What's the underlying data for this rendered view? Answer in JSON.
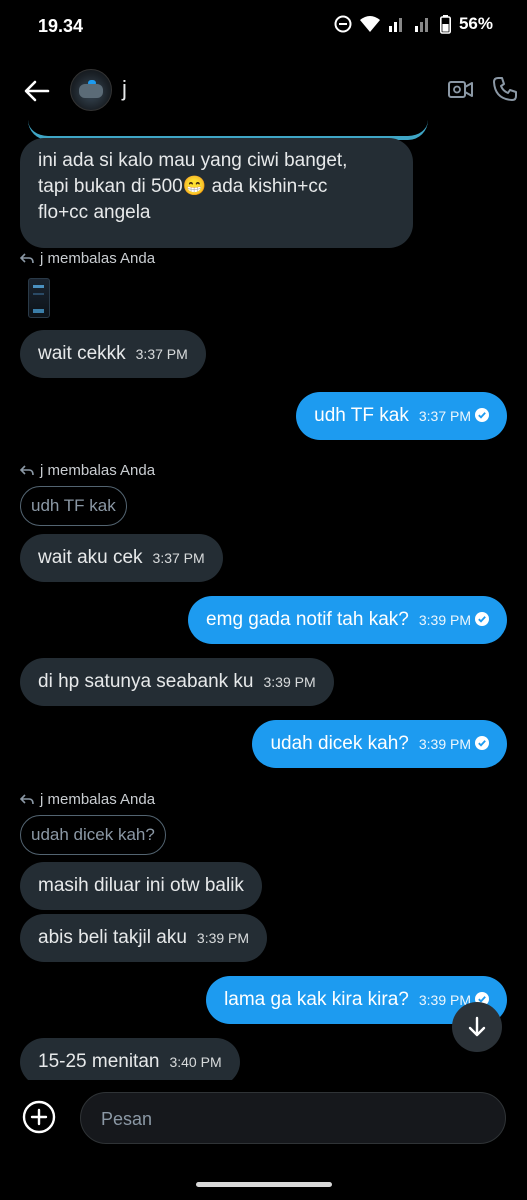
{
  "status_bar": {
    "time": "19.34",
    "battery": "56%"
  },
  "header": {
    "contact_name": "j"
  },
  "messages": {
    "m1": {
      "line1": "ini ada si kalo mau yang ciwi banget,",
      "line2": "tapi bukan di 500😁 ada kishin+cc",
      "line3": "flo+cc angela"
    },
    "r1": {
      "label": "j membalas Anda"
    },
    "m2": {
      "text": "wait cekkk",
      "time": "3:37 PM"
    },
    "m3": {
      "text": "udh TF kak",
      "time": "3:37 PM"
    },
    "r2": {
      "label": "j membalas Anda",
      "quote": "udh TF kak"
    },
    "m4": {
      "text": "wait aku cek",
      "time": "3:37 PM"
    },
    "m5": {
      "text": "emg gada notif tah kak?",
      "time": "3:39 PM"
    },
    "m6": {
      "text": "di hp satunya seabank ku",
      "time": "3:39 PM"
    },
    "m7": {
      "text": "udah dicek kah?",
      "time": "3:39 PM"
    },
    "r3": {
      "label": "j membalas Anda",
      "quote": "udah dicek kah?"
    },
    "m8": {
      "text": "masih diluar ini otw balik"
    },
    "m9": {
      "text": "abis beli takjil aku",
      "time": "3:39 PM"
    },
    "m10": {
      "text": "lama ga kak kira kira?",
      "time": "3:39 PM"
    },
    "m11": {
      "text": "15-25 menitan",
      "time": "3:40 PM"
    }
  },
  "composer": {
    "placeholder": "Pesan"
  },
  "colors": {
    "accent": "#1d9bf0",
    "incoming_bubble": "#242d34",
    "background": "#000000"
  },
  "icons": [
    "back-arrow-icon",
    "video-call-icon",
    "phone-icon",
    "reply-icon",
    "read-check-icon",
    "scroll-down-icon",
    "add-icon"
  ]
}
